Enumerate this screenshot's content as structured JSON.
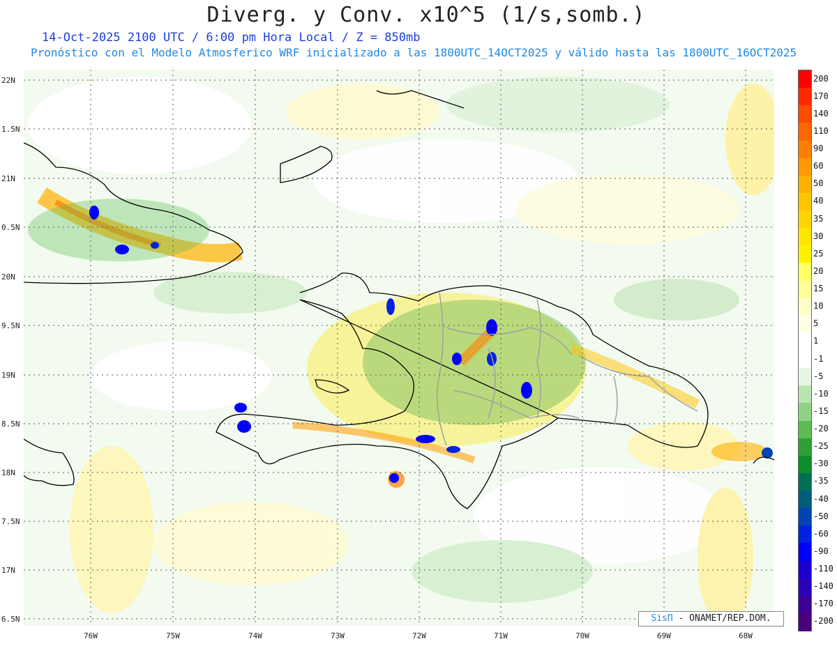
{
  "title": "Diverg. y Conv. x10^5 (1/s,somb.)",
  "subtitle_line1": "14-Oct-2025  2100 UTC / 6:00 pm Hora Local / Z = 850mb",
  "subtitle_line2": "Pronóstico con el Modelo Atmosferico WRF inicializado a las 1800UTC_14OCT2025 y válido hasta las  1800UTC_16OCT2025",
  "map": {
    "lat_labels": [
      "22N",
      "1.5N",
      "21N",
      "0.5N",
      "20N",
      "9.5N",
      "19N",
      "8.5N",
      "18N",
      "7.5N",
      "17N",
      "6.5N"
    ],
    "lon_labels": [
      "76W",
      "75W",
      "74W",
      "73W",
      "72W",
      "71W",
      "70W",
      "69W",
      "68W"
    ],
    "regions": [
      "cuba-east",
      "bahamas-inagua",
      "turks-caicos",
      "hispaniola-haiti",
      "dominican-republic",
      "jamaica-east",
      "puerto-rico-west",
      "navassa"
    ]
  },
  "colorbar": {
    "labels": [
      "200",
      "170",
      "140",
      "110",
      "90",
      "60",
      "50",
      "40",
      "35",
      "30",
      "25",
      "20",
      "15",
      "10",
      "5",
      "1",
      "-1",
      "-5",
      "-10",
      "-15",
      "-20",
      "-25",
      "-30",
      "-35",
      "-40",
      "-50",
      "-60",
      "-90",
      "-110",
      "-140",
      "-170",
      "-200"
    ],
    "colors": [
      "#ff0000",
      "#ff2a00",
      "#ff4a00",
      "#ff6600",
      "#ff7f00",
      "#ff9a00",
      "#ffb000",
      "#ffc400",
      "#ffd400",
      "#ffe600",
      "#fff200",
      "#ffff66",
      "#ffff99",
      "#ffffcc",
      "#ffffe8",
      "#ffffff",
      "#ffffff",
      "#e8f5e2",
      "#b9e4af",
      "#8fd285",
      "#5cbc55",
      "#2ea036",
      "#0a8f2a",
      "#006e55",
      "#005c7a",
      "#0044b4",
      "#0022e0",
      "#0000ff",
      "#1a00d0",
      "#2c00b8",
      "#3c0095",
      "#4a007a"
    ]
  },
  "credit": {
    "logo_text": "SisΠ",
    "text": "- ONAMET/REP.DOM."
  }
}
